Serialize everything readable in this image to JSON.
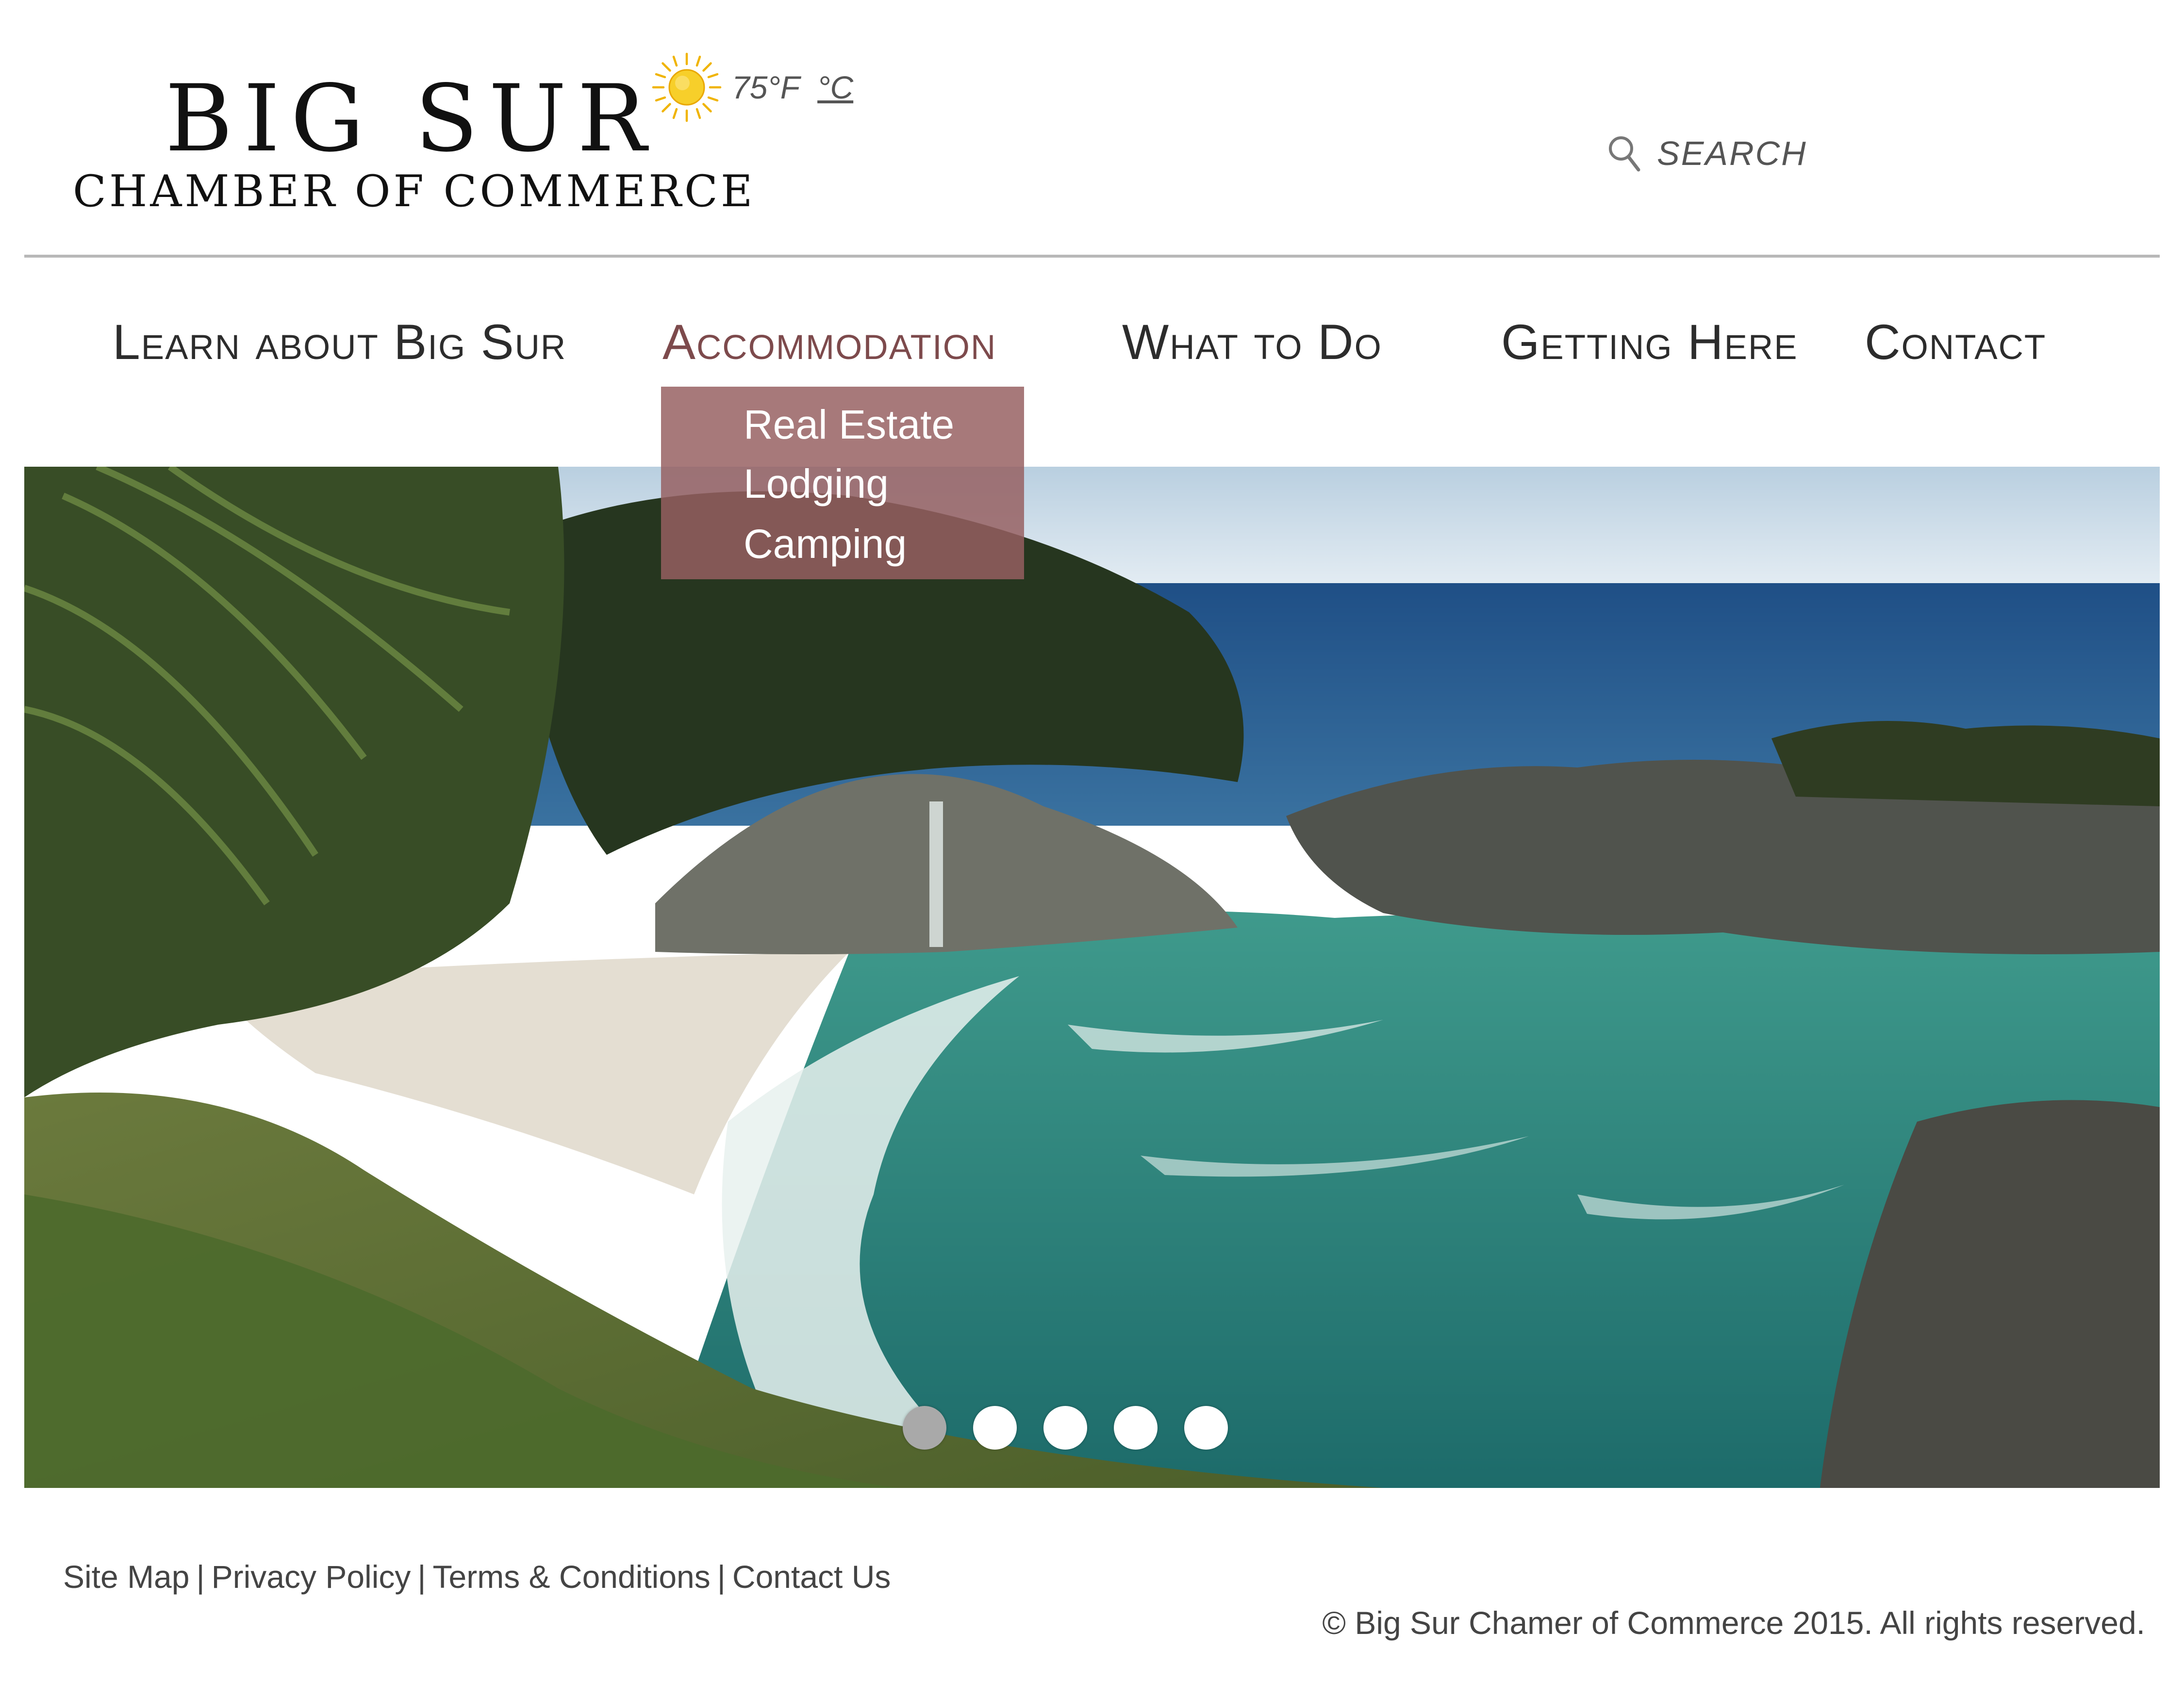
{
  "logo": {
    "title": "BIG SUR",
    "subtitle": "CHAMBER OF COMMERCE"
  },
  "weather": {
    "icon": "sun-icon",
    "temperature": "75°F",
    "alt_unit": "°C",
    "sun_color": "#f3c21b"
  },
  "search": {
    "placeholder": "SEARCH",
    "icon": "search-icon"
  },
  "nav": {
    "items": [
      {
        "label": "Learn about Big Sur"
      },
      {
        "label": "Accommodation",
        "active": true
      },
      {
        "label": "What to Do"
      },
      {
        "label": "Getting Here"
      },
      {
        "label": "Contact"
      }
    ],
    "active_color": "#7d4a4c",
    "dropdown": [
      "Real Estate",
      "Lodging",
      "Camping"
    ],
    "dropdown_color": "#965f61"
  },
  "hero": {
    "slide_count": 5,
    "active_slide": 1
  },
  "footer": {
    "links": [
      "Site Map",
      "Privacy Policy",
      "Terms & Conditions",
      "Contact Us"
    ],
    "separator": "|",
    "copyright": "© Big Sur Chamer of Commerce 2015. All rights reserved."
  }
}
